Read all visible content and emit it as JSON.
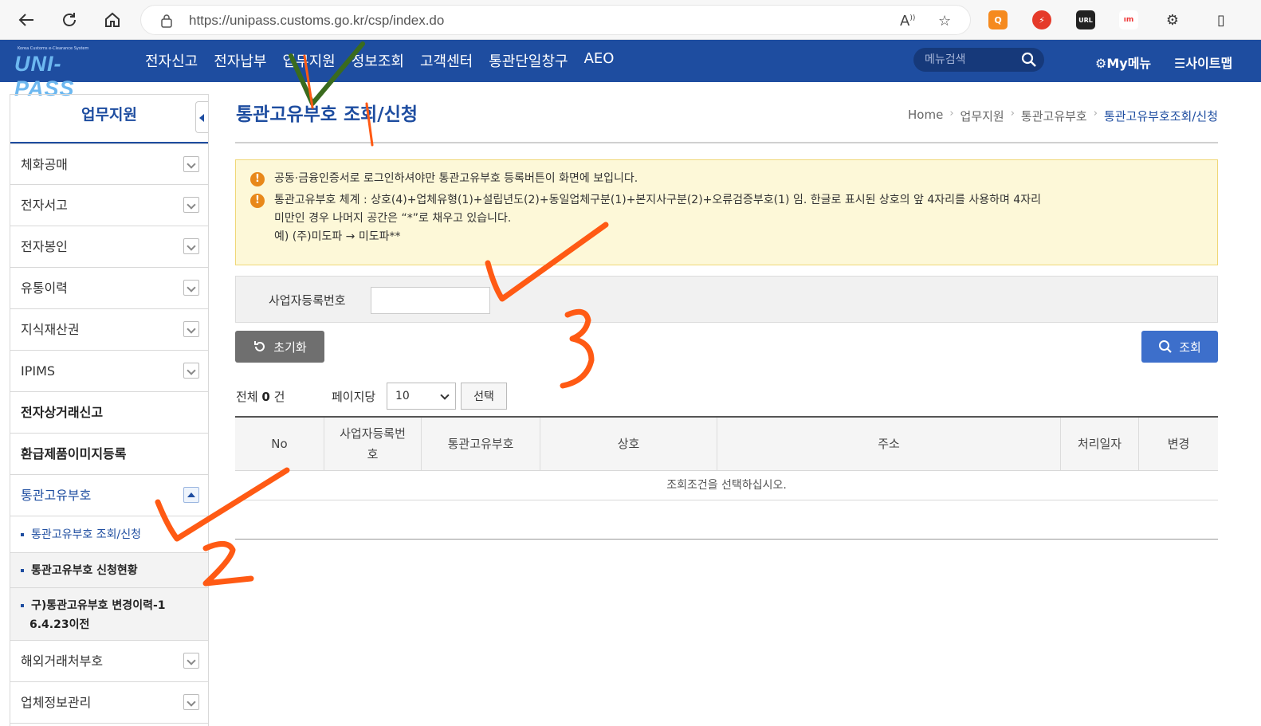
{
  "browser": {
    "url": "https://unipass.customs.go.kr/csp/index.do"
  },
  "header": {
    "logo_small": "Korea Customs e-Clearance System",
    "logo_main": "UNI-PASS",
    "gnb": [
      "전자신고",
      "전자납부",
      "업무지원",
      "정보조회",
      "고객센터",
      "통관단일창구",
      "AEO"
    ],
    "search_placeholder": "메뉴검색",
    "my_menu": "My메뉴",
    "sitemap": "사이트맵"
  },
  "sidebar": {
    "title": "업무지원",
    "items": [
      {
        "label": "체화공매"
      },
      {
        "label": "전자서고"
      },
      {
        "label": "전자봉인"
      },
      {
        "label": "유통이력"
      },
      {
        "label": "지식재산권"
      },
      {
        "label": "IPIMS"
      },
      {
        "label": "전자상거래신고"
      },
      {
        "label": "환급제품이미지등록"
      },
      {
        "label": "통관고유부호"
      },
      {
        "label": "해외거래처부호"
      },
      {
        "label": "업체정보관리"
      }
    ],
    "sub_items": [
      {
        "label": "통관고유부호 조회/신청"
      },
      {
        "label": "통관고유부호 신청현황"
      },
      {
        "label": "구)통관고유부호 변경이력-1",
        "label2": "6.4.23이전"
      }
    ]
  },
  "content": {
    "page_title": "통관고유부호 조회/신청",
    "breadcrumb": [
      "Home",
      "업무지원",
      "통관고유부호",
      "통관고유부호조회/신청"
    ],
    "notice": {
      "line1": "공동·금융인증서로 로그인하셔야만 통관고유부호 등록버튼이 화면에 보입니다.",
      "line2a": "통관고유부호 체계 : 상호(4)+업체유형(1)+설립년도(2)+동일업체구분(1)+본지사구분(2)+오류검증부호(1) 임. 한글로 표시된 상호의 앞 4자리를 사용하며 4자리",
      "line2b": "미만인 경우 나머지 공간은 “*”로 채우고 있습니다.",
      "line2c": "예) (주)미도파 → 미도파**"
    },
    "search_label": "사업자등록번호",
    "search_value": "",
    "reset_button": "초기화",
    "search_button": "조회",
    "total_prefix": "전체",
    "total_count": "0",
    "total_suffix": "건",
    "per_page_label": "페이지당",
    "per_page_value": "10",
    "select_button": "선택",
    "table": {
      "headers": [
        "No",
        "사업자등록번호",
        "통관고유부호",
        "상호",
        "주소",
        "처리일자",
        "변경"
      ],
      "header_business_line1": "사업자등록번",
      "header_business_line2": "호",
      "empty_message": "조회조건을 선택하십시오."
    }
  },
  "colors": {
    "brand": "#1e4da0",
    "annotation_orange": "#ff5a14",
    "annotation_green": "#3a6b1e"
  }
}
